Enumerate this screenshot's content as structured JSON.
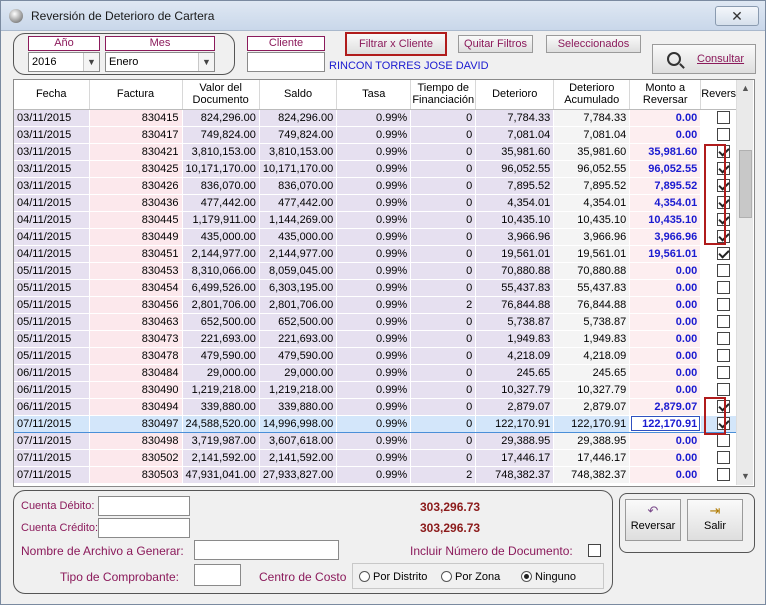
{
  "window": {
    "title": "Reversión de Deterioro de Cartera",
    "close_label": "✕"
  },
  "filters": {
    "year_label": "Año",
    "year_value": "2016",
    "month_label": "Mes",
    "month_value": "Enero",
    "client_label": "Cliente",
    "client_value": "",
    "filter_button": "Filtrar  x  Cliente",
    "clear_button": "Quitar  Filtros",
    "selected_button": "Seleccionados",
    "client_name": "RINCON TORRES JOSE DAVID",
    "consult_button": "Consultar"
  },
  "grid": {
    "headers": [
      "Fecha",
      "Factura",
      "Valor del Documento",
      "Saldo",
      "Tasa",
      "Tiempo de Financiación",
      "Deterioro",
      "Deterioro Acumulado",
      "Monto a Reversar",
      "Reversar"
    ],
    "rows": [
      {
        "fecha": "03/11/2015",
        "factura": "830415",
        "valor": "824,296.00",
        "saldo": "824,296.00",
        "tasa": "0.99%",
        "tiempo": "0",
        "deterioro": "7,784.33",
        "acumulado": "7,784.33",
        "monto": "0.00",
        "checked": false
      },
      {
        "fecha": "03/11/2015",
        "factura": "830417",
        "valor": "749,824.00",
        "saldo": "749,824.00",
        "tasa": "0.99%",
        "tiempo": "0",
        "deterioro": "7,081.04",
        "acumulado": "7,081.04",
        "monto": "0.00",
        "checked": false
      },
      {
        "fecha": "03/11/2015",
        "factura": "830421",
        "valor": "3,810,153.00",
        "saldo": "3,810,153.00",
        "tasa": "0.99%",
        "tiempo": "0",
        "deterioro": "35,981.60",
        "acumulado": "35,981.60",
        "monto": "35,981.60",
        "checked": true
      },
      {
        "fecha": "03/11/2015",
        "factura": "830425",
        "valor": "10,171,170.00",
        "saldo": "10,171,170.00",
        "tasa": "0.99%",
        "tiempo": "0",
        "deterioro": "96,052.55",
        "acumulado": "96,052.55",
        "monto": "96,052.55",
        "checked": true
      },
      {
        "fecha": "03/11/2015",
        "factura": "830426",
        "valor": "836,070.00",
        "saldo": "836,070.00",
        "tasa": "0.99%",
        "tiempo": "0",
        "deterioro": "7,895.52",
        "acumulado": "7,895.52",
        "monto": "7,895.52",
        "checked": true
      },
      {
        "fecha": "04/11/2015",
        "factura": "830436",
        "valor": "477,442.00",
        "saldo": "477,442.00",
        "tasa": "0.99%",
        "tiempo": "0",
        "deterioro": "4,354.01",
        "acumulado": "4,354.01",
        "monto": "4,354.01",
        "checked": true
      },
      {
        "fecha": "04/11/2015",
        "factura": "830445",
        "valor": "1,179,911.00",
        "saldo": "1,144,269.00",
        "tasa": "0.99%",
        "tiempo": "0",
        "deterioro": "10,435.10",
        "acumulado": "10,435.10",
        "monto": "10,435.10",
        "checked": true
      },
      {
        "fecha": "04/11/2015",
        "factura": "830449",
        "valor": "435,000.00",
        "saldo": "435,000.00",
        "tasa": "0.99%",
        "tiempo": "0",
        "deterioro": "3,966.96",
        "acumulado": "3,966.96",
        "monto": "3,966.96",
        "checked": true
      },
      {
        "fecha": "04/11/2015",
        "factura": "830451",
        "valor": "2,144,977.00",
        "saldo": "2,144,977.00",
        "tasa": "0.99%",
        "tiempo": "0",
        "deterioro": "19,561.01",
        "acumulado": "19,561.01",
        "monto": "19,561.01",
        "checked": true
      },
      {
        "fecha": "05/11/2015",
        "factura": "830453",
        "valor": "8,310,066.00",
        "saldo": "8,059,045.00",
        "tasa": "0.99%",
        "tiempo": "0",
        "deterioro": "70,880.88",
        "acumulado": "70,880.88",
        "monto": "0.00",
        "checked": false
      },
      {
        "fecha": "05/11/2015",
        "factura": "830454",
        "valor": "6,499,526.00",
        "saldo": "6,303,195.00",
        "tasa": "0.99%",
        "tiempo": "0",
        "deterioro": "55,437.83",
        "acumulado": "55,437.83",
        "monto": "0.00",
        "checked": false
      },
      {
        "fecha": "05/11/2015",
        "factura": "830456",
        "valor": "2,801,706.00",
        "saldo": "2,801,706.00",
        "tasa": "0.99%",
        "tiempo": "2",
        "deterioro": "76,844.88",
        "acumulado": "76,844.88",
        "monto": "0.00",
        "checked": false
      },
      {
        "fecha": "05/11/2015",
        "factura": "830463",
        "valor": "652,500.00",
        "saldo": "652,500.00",
        "tasa": "0.99%",
        "tiempo": "0",
        "deterioro": "5,738.87",
        "acumulado": "5,738.87",
        "monto": "0.00",
        "checked": false
      },
      {
        "fecha": "05/11/2015",
        "factura": "830473",
        "valor": "221,693.00",
        "saldo": "221,693.00",
        "tasa": "0.99%",
        "tiempo": "0",
        "deterioro": "1,949.83",
        "acumulado": "1,949.83",
        "monto": "0.00",
        "checked": false
      },
      {
        "fecha": "05/11/2015",
        "factura": "830478",
        "valor": "479,590.00",
        "saldo": "479,590.00",
        "tasa": "0.99%",
        "tiempo": "0",
        "deterioro": "4,218.09",
        "acumulado": "4,218.09",
        "monto": "0.00",
        "checked": false
      },
      {
        "fecha": "06/11/2015",
        "factura": "830484",
        "valor": "29,000.00",
        "saldo": "29,000.00",
        "tasa": "0.99%",
        "tiempo": "0",
        "deterioro": "245.65",
        "acumulado": "245.65",
        "monto": "0.00",
        "checked": false
      },
      {
        "fecha": "06/11/2015",
        "factura": "830490",
        "valor": "1,219,218.00",
        "saldo": "1,219,218.00",
        "tasa": "0.99%",
        "tiempo": "0",
        "deterioro": "10,327.79",
        "acumulado": "10,327.79",
        "monto": "0.00",
        "checked": false
      },
      {
        "fecha": "06/11/2015",
        "factura": "830494",
        "valor": "339,880.00",
        "saldo": "339,880.00",
        "tasa": "0.99%",
        "tiempo": "0",
        "deterioro": "2,879.07",
        "acumulado": "2,879.07",
        "monto": "2,879.07",
        "checked": true
      },
      {
        "fecha": "07/11/2015",
        "factura": "830497",
        "valor": "24,588,520.00",
        "saldo": "14,996,998.00",
        "tasa": "0.99%",
        "tiempo": "0",
        "deterioro": "122,170.91",
        "acumulado": "122,170.91",
        "monto": "122,170.91",
        "checked": true,
        "selected": true
      },
      {
        "fecha": "07/11/2015",
        "factura": "830498",
        "valor": "3,719,987.00",
        "saldo": "3,607,618.00",
        "tasa": "0.99%",
        "tiempo": "0",
        "deterioro": "29,388.95",
        "acumulado": "29,388.95",
        "monto": "0.00",
        "checked": false
      },
      {
        "fecha": "07/11/2015",
        "factura": "830502",
        "valor": "2,141,592.00",
        "saldo": "2,141,592.00",
        "tasa": "0.99%",
        "tiempo": "0",
        "deterioro": "17,446.17",
        "acumulado": "17,446.17",
        "monto": "0.00",
        "checked": false
      },
      {
        "fecha": "07/11/2015",
        "factura": "830503",
        "valor": "47,931,041.00",
        "saldo": "27,933,827.00",
        "tasa": "0.99%",
        "tiempo": "2",
        "deterioro": "748,382.37",
        "acumulado": "748,382.37",
        "monto": "0.00",
        "checked": false
      }
    ]
  },
  "bottom": {
    "debit_label": "Cuenta Débito:",
    "debit_total": "303,296.73",
    "credit_label": "Cuenta Crédito:",
    "credit_total": "303,296.73",
    "file_label": "Nombre de Archivo a Generar:",
    "include_doc_label": "Incluir Número de Documento:",
    "voucher_label": "Tipo de Comprobante:",
    "cost_center_label": "Centro de Costo",
    "radio_district": "Por Distrito",
    "radio_zone": "Por Zona",
    "radio_none": "Ninguno",
    "reverse_button": "Reversar",
    "exit_button": "Salir"
  },
  "colors": {
    "accent": "#8b1a5b",
    "amount_blue": "#1a1ad0",
    "highlight_red": "#b01c1c",
    "total_red": "#8b1a1a"
  }
}
